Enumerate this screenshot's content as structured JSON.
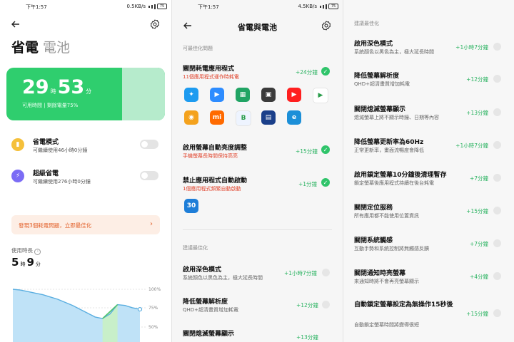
{
  "status": {
    "left_time": "下午1:57",
    "left_net": "0.5KB/s",
    "mid_time": "下午1:57",
    "mid_net": "4.5KB/s",
    "battery": "75"
  },
  "panel1": {
    "title": "省電",
    "title_sub": "電池",
    "remaining": {
      "hours": "29",
      "hours_unit": "時",
      "minutes": "53",
      "minutes_unit": "分",
      "sub": "可用時間 | 剩餘電量75%"
    },
    "battery_level_percent": 75,
    "modes": [
      {
        "title": "省電模式",
        "desc": "可繼續使用46小時0分鐘",
        "icon": "battery-saver-icon",
        "color": "#f5c03b"
      },
      {
        "title": "超級省電",
        "desc": "可繼續使用276小時0分鐘",
        "icon": "lightning-icon",
        "color": "#7b6cf5"
      }
    ],
    "warning": "發現3個耗電問題，立即最佳化",
    "usage_label": "使用時長",
    "usage": {
      "hours": "5",
      "hours_unit": "時",
      "minutes": "9",
      "minutes_unit": "分"
    },
    "chart_axis": [
      "100%",
      "75%",
      "50%"
    ],
    "chart_data": {
      "type": "area",
      "y_ticks": [
        "100%",
        "75%",
        "50%"
      ],
      "ylim": [
        50,
        100
      ],
      "values": [
        100,
        99,
        97,
        95,
        93,
        90,
        87,
        83,
        79,
        74,
        69,
        64,
        62,
        68,
        80,
        79,
        76,
        74
      ]
    }
  },
  "panel2": {
    "title": "省電與電池",
    "section_optimizable": "可最佳化問題",
    "issues": [
      {
        "title": "關閉耗電應用程式",
        "desc": "11個應用程式運作時耗電",
        "gain": "+24分鐘"
      },
      {
        "title": "啟用螢幕自動亮度調整",
        "desc": "手機螢幕長時間保持高亮",
        "gain": "+15分鐘"
      },
      {
        "title": "禁止應用程式自動啟動",
        "desc": "1個應用程式頻繁自動啟動",
        "gain": "+1分鐘"
      }
    ],
    "apps_row1": [
      {
        "name": "twitter-icon",
        "color": "#1d9bf0",
        "glyph": "✦"
      },
      {
        "name": "zoom-icon",
        "color": "#2d8cff",
        "glyph": "▶"
      },
      {
        "name": "sheets-icon",
        "color": "#21a464",
        "glyph": "▦"
      },
      {
        "name": "news-app-icon",
        "color": "#3b3b3b",
        "glyph": "▣"
      },
      {
        "name": "youtube-icon",
        "color": "#ff1f1f",
        "glyph": "▶"
      },
      {
        "name": "play-store-icon",
        "color": "#ffffff",
        "glyph": "▶"
      }
    ],
    "apps_row2": [
      {
        "name": "mi-home-icon",
        "color": "#f4a21d",
        "glyph": "◉"
      },
      {
        "name": "mi-store-icon",
        "color": "#ff6a00",
        "glyph": "mi"
      },
      {
        "name": "doc-app-icon",
        "color": "#eef4ff",
        "glyph": "B"
      },
      {
        "name": "news-thumb-icon",
        "color": "#1a3f8a",
        "glyph": "▤"
      },
      {
        "name": "edge-icon",
        "color": "#1c8fd8",
        "glyph": "e"
      }
    ],
    "autostart_app": {
      "name": "app-30-icon",
      "color": "#1e7ed8",
      "glyph": "30"
    },
    "section_suggested": "建議最佳化",
    "suggested": [
      {
        "title": "啟用深色模式",
        "desc": "系統顏色以黑色為主，極大延長時間",
        "gain": "+1小時7分鐘"
      },
      {
        "title": "降低螢幕解析度",
        "desc": "QHD+超清畫質增加耗電",
        "gain": "+12分鐘"
      },
      {
        "title": "關閉熄滅螢幕顯示",
        "desc": "",
        "gain": "+13分鐘"
      }
    ]
  },
  "panel3": {
    "section_suggested": "建議最佳化",
    "items": [
      {
        "title": "啟用深色模式",
        "desc": "系統顏色以黑色為主，極大延長時間",
        "gain": "+1小時7分鐘"
      },
      {
        "title": "降低螢幕解析度",
        "desc": "QHD+超清畫質增加耗電",
        "gain": "+12分鐘"
      },
      {
        "title": "關閉熄滅螢幕顯示",
        "desc": "熄滅螢幕上將不顯示時鐘、日期等內容",
        "gain": "+13分鐘"
      },
      {
        "title": "降低螢幕更新率為60Hz",
        "desc": "正常更新率，畫面流暢度會降低",
        "gain": "+1小時7分鐘"
      },
      {
        "title": "啟用鎖定螢幕10分鐘後清理暫存",
        "desc": "鎖定螢幕後應用程式持續在後台耗電",
        "gain": "+7分鐘"
      },
      {
        "title": "關閉定位服務",
        "desc": "所有應用都不能使用位置資訊",
        "gain": "+15分鐘"
      },
      {
        "title": "關閉系統觸感",
        "desc": "互動手勢和系統控制將無觸感反饋",
        "gain": "+7分鐘"
      },
      {
        "title": "關閉通知時亮螢幕",
        "desc": "來通知時將不會再亮螢幕顯示",
        "gain": "+4分鐘"
      },
      {
        "title": "自動鎖定螢幕設定為無操作15秒後",
        "desc": "自動鎖定螢幕時間將變得很短",
        "gain": "+15分鐘"
      }
    ]
  },
  "colors": {
    "accent_green": "#2fce6e",
    "gain_green": "#2bb361",
    "warning_orange": "#e2602a"
  }
}
